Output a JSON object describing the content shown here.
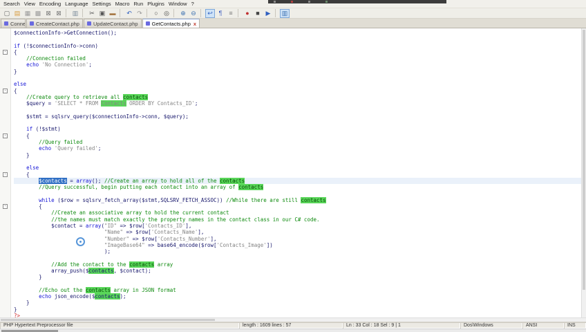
{
  "menu": {
    "items": [
      "Search",
      "View",
      "Encoding",
      "Language",
      "Settings",
      "Macro",
      "Run",
      "Plugins",
      "Window",
      "?"
    ]
  },
  "toolbar": {
    "icons": [
      {
        "name": "new-file-icon",
        "glyph": "▢",
        "color": "#666"
      },
      {
        "name": "open-file-icon",
        "glyph": "▤",
        "color": "#D89B3C"
      },
      {
        "name": "save-file-icon",
        "glyph": "▦",
        "color": "#9A9A9A"
      },
      {
        "name": "save-all-icon",
        "glyph": "▩",
        "color": "#9A9A9A"
      },
      {
        "name": "close-file-icon",
        "glyph": "⊠",
        "color": "#777"
      },
      {
        "name": "close-all-icon",
        "glyph": "⊠",
        "color": "#777"
      },
      {
        "sep": true
      },
      {
        "name": "print-icon",
        "glyph": "▥",
        "color": "#7A8A9A"
      },
      {
        "sep": true
      },
      {
        "name": "cut-icon",
        "glyph": "✂",
        "color": "#555"
      },
      {
        "name": "copy-icon",
        "glyph": "▣",
        "color": "#555"
      },
      {
        "name": "paste-icon",
        "glyph": "▬",
        "color": "#A87B48"
      },
      {
        "sep": true
      },
      {
        "name": "undo-icon",
        "glyph": "↶",
        "color": "#3060C0"
      },
      {
        "name": "redo-icon",
        "glyph": "↷",
        "color": "#999"
      },
      {
        "sep": true
      },
      {
        "name": "find-icon",
        "glyph": "○",
        "color": "#444"
      },
      {
        "name": "replace-icon",
        "glyph": "◎",
        "color": "#444"
      },
      {
        "sep": true
      },
      {
        "name": "zoom-in-icon",
        "glyph": "⊕",
        "color": "#3A6FB0"
      },
      {
        "name": "zoom-out-icon",
        "glyph": "⊖",
        "color": "#3A6FB0"
      },
      {
        "sep": true
      },
      {
        "name": "word-wrap-icon",
        "glyph": "↩",
        "color": "#3060C0",
        "pressed": true
      },
      {
        "name": "show-all-chars-icon",
        "glyph": "¶",
        "color": "#4060C0"
      },
      {
        "name": "indent-guides-icon",
        "glyph": "≡",
        "color": "#777"
      },
      {
        "sep": true
      },
      {
        "name": "record-macro-icon",
        "glyph": "●",
        "color": "#C03030"
      },
      {
        "name": "stop-macro-icon",
        "glyph": "■",
        "color": "#444"
      },
      {
        "name": "play-macro-icon",
        "glyph": "▶",
        "color": "#3060C0"
      },
      {
        "sep": true
      },
      {
        "name": "document-map-icon",
        "glyph": "▥",
        "color": "#3A6FB0",
        "pressed": true
      }
    ]
  },
  "tabs": {
    "items": [
      {
        "label": "Connection.php",
        "active": false,
        "width": 36
      },
      {
        "label": "CreateContact.php",
        "active": false
      },
      {
        "label": "UpdateContact.php",
        "active": false
      },
      {
        "label": "GetContacts.php",
        "active": true
      }
    ],
    "close_glyph": "x"
  },
  "editor": {
    "fold_lines": [
      3,
      9,
      16,
      22,
      27
    ],
    "lines": [
      {
        "s": [
          [
            "d",
            "$connectionInfo->GetConnection();"
          ]
        ]
      },
      {
        "s": []
      },
      {
        "s": [
          [
            "k",
            "if"
          ],
          [
            "d",
            " (!$connectionInfo->conn)"
          ]
        ]
      },
      {
        "s": [
          [
            "d",
            "{"
          ]
        ]
      },
      {
        "s": [
          [
            "d",
            "    "
          ],
          [
            "c",
            "//Connection failed"
          ]
        ]
      },
      {
        "s": [
          [
            "d",
            "    "
          ],
          [
            "k",
            "echo"
          ],
          [
            "d",
            " "
          ],
          [
            "s",
            "'No Connection'"
          ],
          [
            "d",
            ";"
          ]
        ]
      },
      {
        "s": [
          [
            "d",
            "}"
          ]
        ]
      },
      {
        "s": []
      },
      {
        "s": [
          [
            "k",
            "else"
          ]
        ]
      },
      {
        "s": [
          [
            "d",
            "{"
          ]
        ]
      },
      {
        "s": [
          [
            "d",
            "    "
          ],
          [
            "c",
            "//Create query to retrieve all "
          ],
          [
            "c hl",
            "contacts"
          ]
        ]
      },
      {
        "s": [
          [
            "d",
            "    $query = "
          ],
          [
            "s",
            "'SELECT * FROM "
          ],
          [
            "s hl",
            "Contacts"
          ],
          [
            "s",
            " ORDER BY Contacts_ID'"
          ],
          [
            "d",
            ";"
          ]
        ]
      },
      {
        "s": []
      },
      {
        "s": [
          [
            "d",
            "    $stmt = sqlsrv_query($connectionInfo->conn, $query);"
          ]
        ]
      },
      {
        "s": []
      },
      {
        "s": [
          [
            "d",
            "    "
          ],
          [
            "k",
            "if"
          ],
          [
            "d",
            " (!$stmt)"
          ]
        ]
      },
      {
        "s": [
          [
            "d",
            "    {"
          ]
        ]
      },
      {
        "s": [
          [
            "d",
            "        "
          ],
          [
            "c",
            "//Query failed"
          ]
        ]
      },
      {
        "s": [
          [
            "d",
            "        "
          ],
          [
            "k",
            "echo"
          ],
          [
            "d",
            " "
          ],
          [
            "s",
            "'Query failed'"
          ],
          [
            "d",
            ";"
          ]
        ]
      },
      {
        "s": [
          [
            "d",
            "    }"
          ]
        ]
      },
      {
        "s": []
      },
      {
        "s": [
          [
            "d",
            "    "
          ],
          [
            "k",
            "else"
          ]
        ]
      },
      {
        "s": [
          [
            "d",
            "    {"
          ]
        ]
      },
      {
        "cur": true,
        "s": [
          [
            "d",
            "        "
          ],
          [
            "sel",
            "$contacts"
          ],
          [
            "d",
            " = "
          ],
          [
            "k",
            "array"
          ],
          [
            "d",
            "(); "
          ],
          [
            "c",
            "//Create an array to hold all of the "
          ],
          [
            "c hl",
            "contacts"
          ]
        ]
      },
      {
        "s": [
          [
            "d",
            "        "
          ],
          [
            "c",
            "//Query successful, begin putting each contact into an array of "
          ],
          [
            "c hl",
            "contacts"
          ]
        ]
      },
      {
        "s": []
      },
      {
        "s": [
          [
            "d",
            "        "
          ],
          [
            "k",
            "while"
          ],
          [
            "d",
            " ($row = sqlsrv_fetch_array($stmt,SQLSRV_FETCH_ASSOC)) "
          ],
          [
            "c",
            "//While there are still "
          ],
          [
            "c hl",
            "contacts"
          ]
        ]
      },
      {
        "s": [
          [
            "d",
            "        {"
          ]
        ]
      },
      {
        "s": [
          [
            "d",
            "            "
          ],
          [
            "c",
            "//Create an associative array to hold the current contact"
          ]
        ]
      },
      {
        "s": [
          [
            "d",
            "            "
          ],
          [
            "c",
            "//the names must match exactly the property names in the contact class in our C# code."
          ]
        ]
      },
      {
        "s": [
          [
            "d",
            "            $contact = "
          ],
          [
            "k",
            "array"
          ],
          [
            "d",
            "("
          ],
          [
            "s",
            "\"ID\""
          ],
          [
            "d",
            " => $row["
          ],
          [
            "s",
            "'Contacts_ID'"
          ],
          [
            "d",
            "],"
          ]
        ]
      },
      {
        "s": [
          [
            "d",
            "                             "
          ],
          [
            "s",
            "\"Name\""
          ],
          [
            "d",
            " => $row["
          ],
          [
            "s",
            "'Contacts_Name'"
          ],
          [
            "d",
            "],"
          ]
        ]
      },
      {
        "s": [
          [
            "d",
            "                             "
          ],
          [
            "s",
            "\"Number\""
          ],
          [
            "d",
            " => $row["
          ],
          [
            "s",
            "'Contacts_Number'"
          ],
          [
            "d",
            "],"
          ]
        ]
      },
      {
        "s": [
          [
            "d",
            "                             "
          ],
          [
            "s",
            "\"ImageBase64\""
          ],
          [
            "d",
            " => base64_encode($row["
          ],
          [
            "s",
            "'Contacts_Image'"
          ],
          [
            "d",
            "])"
          ]
        ]
      },
      {
        "s": [
          [
            "d",
            "                             );"
          ]
        ]
      },
      {
        "s": []
      },
      {
        "s": [
          [
            "d",
            "            "
          ],
          [
            "c",
            "//Add the contact to the "
          ],
          [
            "c hl",
            "contacts"
          ],
          [
            "c",
            " array"
          ]
        ]
      },
      {
        "s": [
          [
            "d",
            "            array_push($"
          ],
          [
            "d hl",
            "contacts"
          ],
          [
            "d",
            ", $contact);"
          ]
        ]
      },
      {
        "s": [
          [
            "d",
            "        }"
          ]
        ]
      },
      {
        "s": []
      },
      {
        "s": [
          [
            "d",
            "        "
          ],
          [
            "c",
            "//Echo out the "
          ],
          [
            "c hl",
            "contacts"
          ],
          [
            "c",
            " array in JSON format"
          ]
        ]
      },
      {
        "s": [
          [
            "d",
            "        "
          ],
          [
            "k",
            "echo"
          ],
          [
            "d",
            " json_encode($"
          ],
          [
            "d hl",
            "contacts"
          ],
          [
            "d",
            ");"
          ]
        ]
      },
      {
        "s": [
          [
            "d",
            "    }"
          ]
        ]
      },
      {
        "s": [
          [
            "d",
            "}"
          ]
        ]
      },
      {
        "s": [
          [
            "t",
            "?>"
          ]
        ]
      }
    ]
  },
  "status_bar": {
    "doc_type": "PHP Hypertext Preprocessor file",
    "length": "length : 1609     lines : 57",
    "position": "Ln : 33    Col : 18    Sel : 9 | 1",
    "eol": "Dos\\Windows",
    "encoding": "ANSI",
    "typing_mode": "INS"
  }
}
